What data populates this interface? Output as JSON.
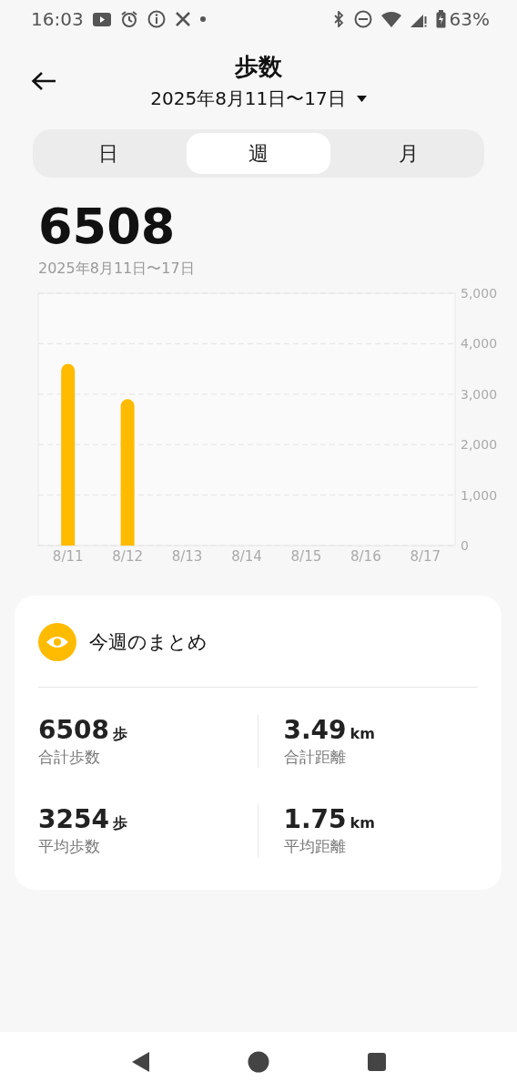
{
  "status_bar": {
    "time": "16:03",
    "battery": "63%"
  },
  "header": {
    "title": "歩数",
    "date_range": "2025年8月11日〜17日"
  },
  "tabs": [
    {
      "label": "日",
      "selected": false
    },
    {
      "label": "週",
      "selected": true
    },
    {
      "label": "月",
      "selected": false
    }
  ],
  "total": {
    "value": "6508",
    "date_range": "2025年8月11日〜17日"
  },
  "chart_data": {
    "type": "bar",
    "categories": [
      "8/11",
      "8/12",
      "8/13",
      "8/14",
      "8/15",
      "8/16",
      "8/17"
    ],
    "series": [
      {
        "color": "#ffbb00",
        "values": [
          3600,
          2900,
          null,
          null,
          null,
          null,
          null
        ]
      }
    ],
    "ylim": [
      0,
      5000
    ],
    "grid": true,
    "yticks": [
      {
        "value": 0,
        "label": "0"
      },
      {
        "value": 1000,
        "label": "1,000"
      },
      {
        "value": 2000,
        "label": "2,000"
      },
      {
        "value": 3000,
        "label": "3,000"
      },
      {
        "value": 4000,
        "label": "4,000"
      },
      {
        "value": 5000,
        "label": "5,000"
      }
    ]
  },
  "summary": {
    "title": "今週のまとめ",
    "stats": [
      {
        "value": "6508",
        "unit": "歩",
        "label": "合計歩数"
      },
      {
        "value": "3.49",
        "unit": "km",
        "label": "合計距離"
      },
      {
        "value": "3254",
        "unit": "歩",
        "label": "平均歩数"
      },
      {
        "value": "1.75",
        "unit": "km",
        "label": "平均距離"
      }
    ]
  }
}
